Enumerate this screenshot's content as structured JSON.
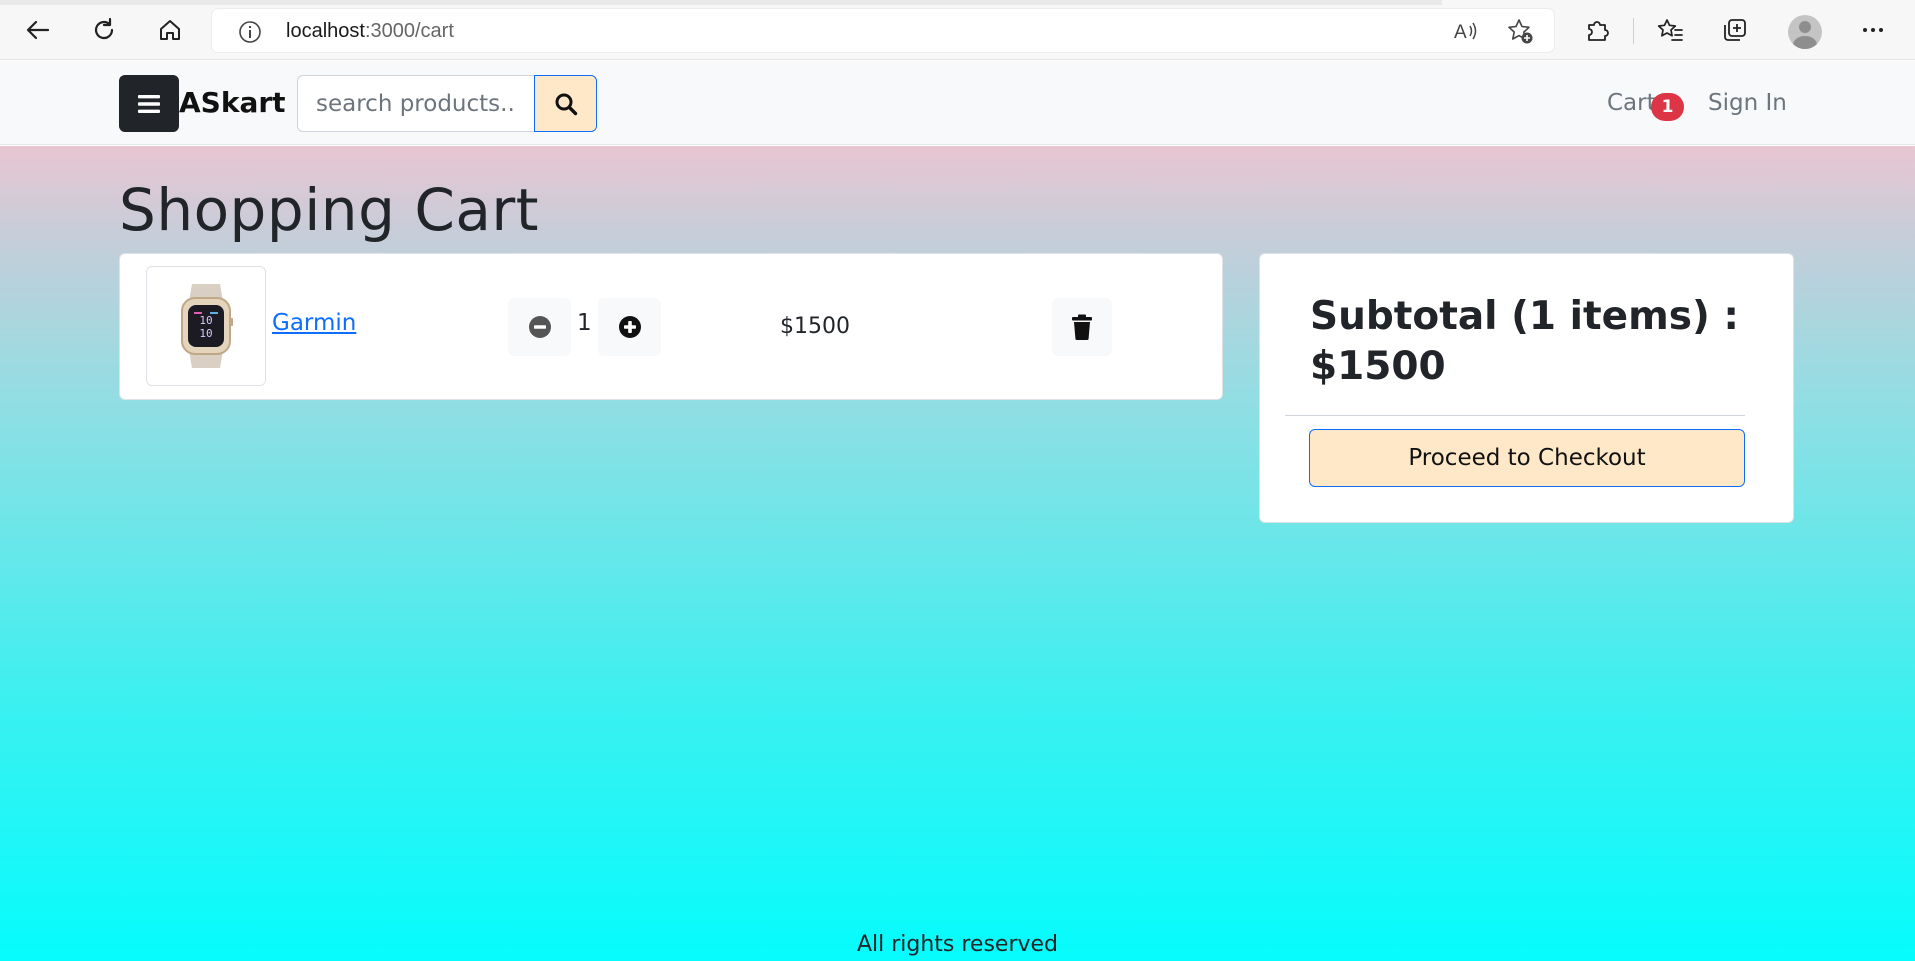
{
  "browser": {
    "url_host": "localhost",
    "url_path": ":3000/cart",
    "icons": [
      "back-arrow-icon",
      "refresh-icon",
      "home-icon",
      "info-icon",
      "read-aloud-icon",
      "add-favorite-icon",
      "extensions-icon",
      "favorites-icon",
      "collections-icon",
      "profile-icon",
      "more-icon"
    ]
  },
  "navbar": {
    "brand": "ASkart",
    "search_placeholder": "search products...",
    "cart_label": "Cart",
    "cart_count": "1",
    "signin_label": "Sign In"
  },
  "main": {
    "title": "Shopping Cart",
    "items": [
      {
        "name": "Garmin",
        "quantity": "1",
        "price": "$1500"
      }
    ]
  },
  "summary": {
    "subtotal_label": "Subtotal (1 items) :",
    "subtotal_amount": "$1500",
    "checkout_label": "Proceed to Checkout"
  },
  "footer": {
    "text": "All rights reserved"
  },
  "colors": {
    "accent": "#0d6efd",
    "button_bg": "#ffe8c8",
    "badge": "#dc3545",
    "dark": "#212529"
  }
}
